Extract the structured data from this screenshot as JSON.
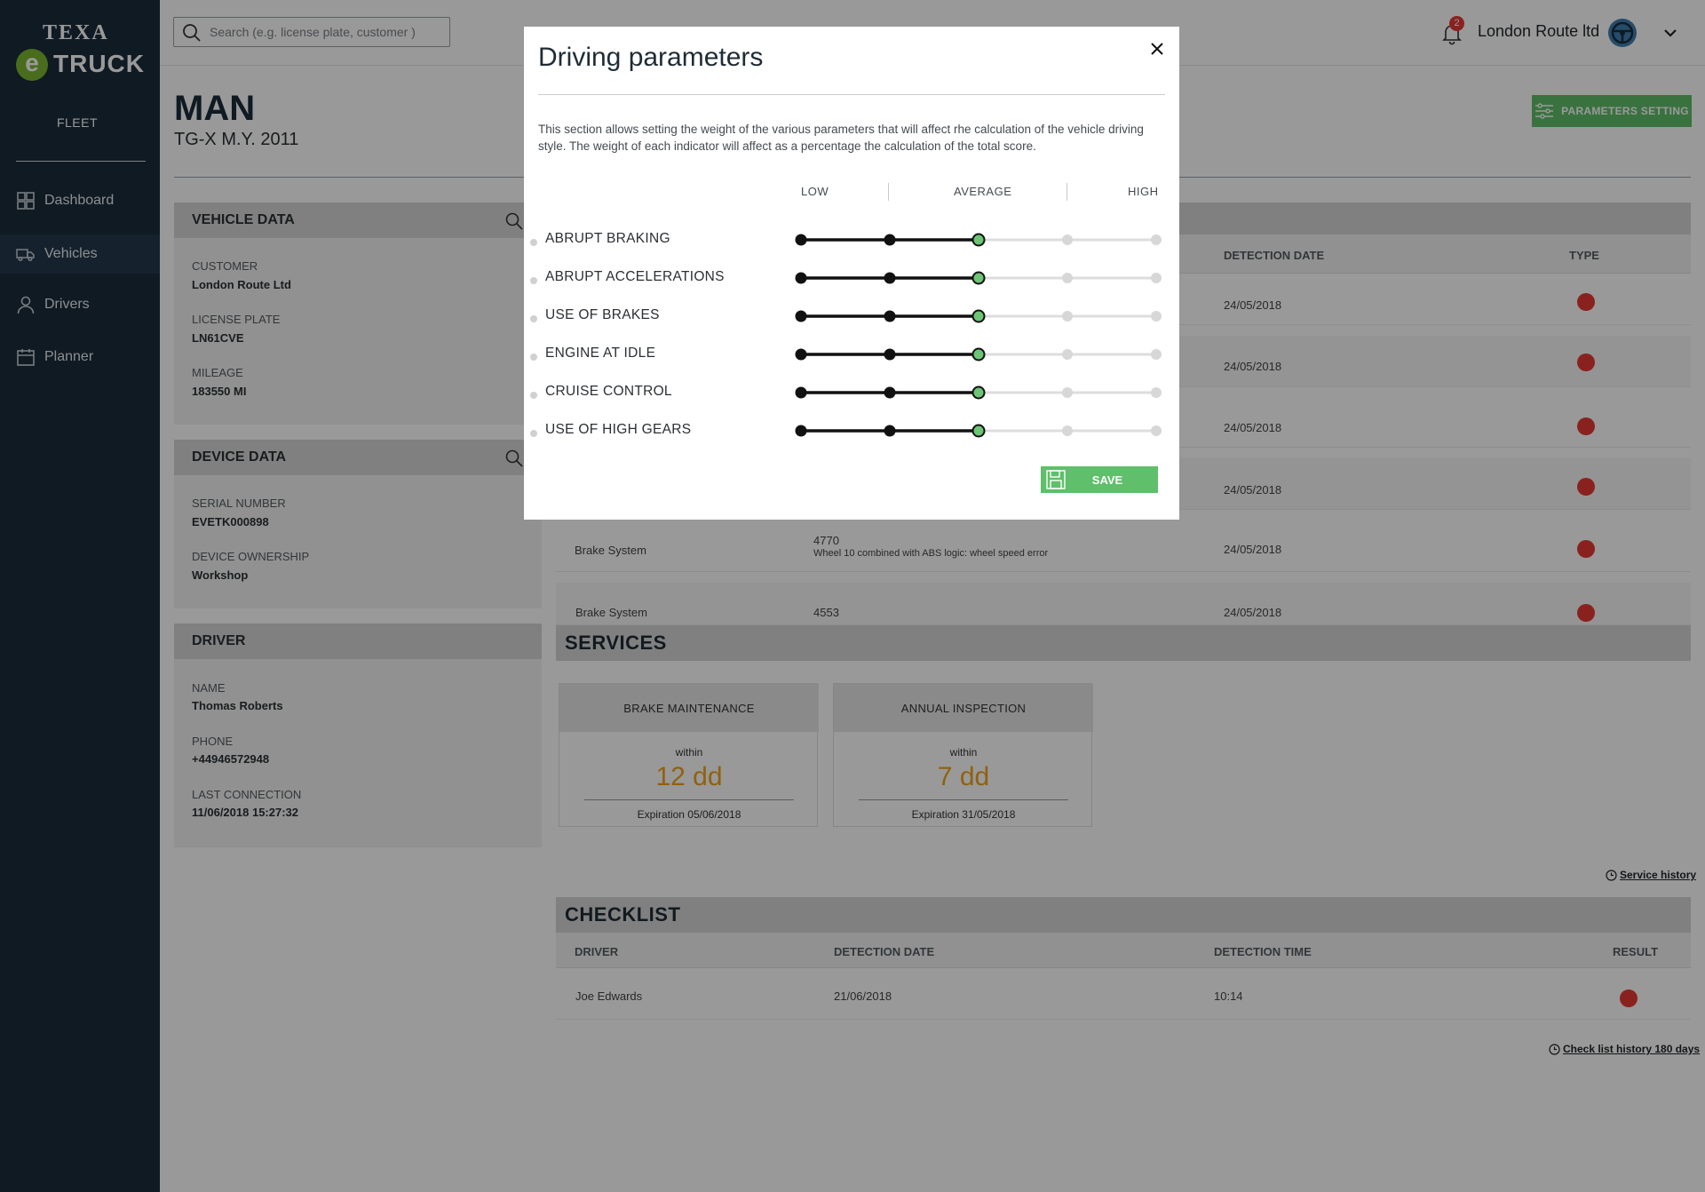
{
  "sidebar": {
    "logo_texa": "TEXA",
    "logo_e": "e",
    "logo_truck": "TRUCK",
    "section": "FLEET",
    "items": [
      {
        "label": "Dashboard",
        "icon": "dashboard-icon",
        "active": false
      },
      {
        "label": "Vehicles",
        "icon": "truck-icon",
        "active": true
      },
      {
        "label": "Drivers",
        "icon": "person-icon",
        "active": false
      },
      {
        "label": "Planner",
        "icon": "calendar-icon",
        "active": false
      }
    ]
  },
  "header": {
    "search_placeholder": "Search (e.g. license plate, customer )",
    "notification_count": "2",
    "company": "London Route ltd"
  },
  "vehicle": {
    "make": "MAN",
    "model": "TG-X  M.Y. 2011",
    "parameters_button": "PARAMETERS SETTING"
  },
  "vehicle_data": {
    "title": "VEHICLE DATA",
    "customer_label": "CUSTOMER",
    "customer": "London Route Ltd",
    "plate_label": "LICENSE PLATE",
    "plate": "LN61CVE",
    "mileage_label": "MILEAGE",
    "mileage": "183550 MI"
  },
  "device_data": {
    "title": "DEVICE DATA",
    "serial_label": "SERIAL NUMBER",
    "serial": "EVETK000898",
    "ownership_label": "DEVICE OWNERSHIP",
    "ownership": "Workshop"
  },
  "driver": {
    "title": "DRIVER",
    "name_label": "NAME",
    "name": "Thomas Roberts",
    "phone_label": "PHONE",
    "phone": "+44946572948",
    "last_label": "LAST CONNECTION",
    "last": "11/06/2018 15:27:32"
  },
  "alerts": {
    "col_date": "DETECTION DATE",
    "col_type": "TYPE",
    "rows": [
      {
        "system": "",
        "code": "",
        "desc": "",
        "date": "24/05/2018"
      },
      {
        "system": "",
        "code": "",
        "desc": "",
        "date": "24/05/2018"
      },
      {
        "system": "",
        "code": "",
        "desc": "",
        "date": "24/05/2018"
      },
      {
        "system": "",
        "code": "",
        "desc": "",
        "date": "24/05/2018"
      },
      {
        "system": "Brake System",
        "code": "4770",
        "desc": "Wheel 10 combined with ABS logic: wheel speed error",
        "date": "24/05/2018"
      },
      {
        "system": "Brake System",
        "code": "4553",
        "desc": "",
        "date": "24/05/2018"
      }
    ]
  },
  "services": {
    "title": "SERVICES",
    "cards": [
      {
        "name": "BRAKE MAINTENANCE",
        "within": "within",
        "days": "12 dd",
        "expiration": "Expiration 05/06/2018"
      },
      {
        "name": "ANNUAL INSPECTION",
        "within": "within",
        "days": "7 dd",
        "expiration": "Expiration 31/05/2018"
      }
    ],
    "history_link": "Service history"
  },
  "checklist": {
    "title": "CHECKLIST",
    "col_driver": "DRIVER",
    "col_date": "DETECTION DATE",
    "col_time": "DETECTION TIME",
    "col_result": "RESULT",
    "rows": [
      {
        "driver": "Joe Edwards",
        "date": "21/06/2018",
        "time": "10:14"
      }
    ],
    "history_link": "Check list history 180 days"
  },
  "modal": {
    "title": "Driving parameters",
    "description": "This section allows setting the weight of the various parameters that will affect rhe calculation of the vehicle driving style. The weight of each indicator will affect as a percentage the calculation of the total score.",
    "scale_low": "LOW",
    "scale_average": "AVERAGE",
    "scale_high": "HIGH",
    "steps": 5,
    "parameters": [
      {
        "label": "ABRUPT BRAKING",
        "level": 3
      },
      {
        "label": "ABRUPT ACCELERATIONS",
        "level": 3
      },
      {
        "label": "USE OF BRAKES",
        "level": 3
      },
      {
        "label": "ENGINE AT IDLE",
        "level": 3
      },
      {
        "label": "CRUISE CONTROL",
        "level": 3
      },
      {
        "label": "USE OF HIGH GEARS",
        "level": 3
      }
    ],
    "save_label": "SAVE"
  },
  "colors": {
    "sidebar": "#1a2c3b",
    "accent_green": "#5fbf6a",
    "alert_red": "#e53935",
    "service_orange": "#f0a21b"
  }
}
